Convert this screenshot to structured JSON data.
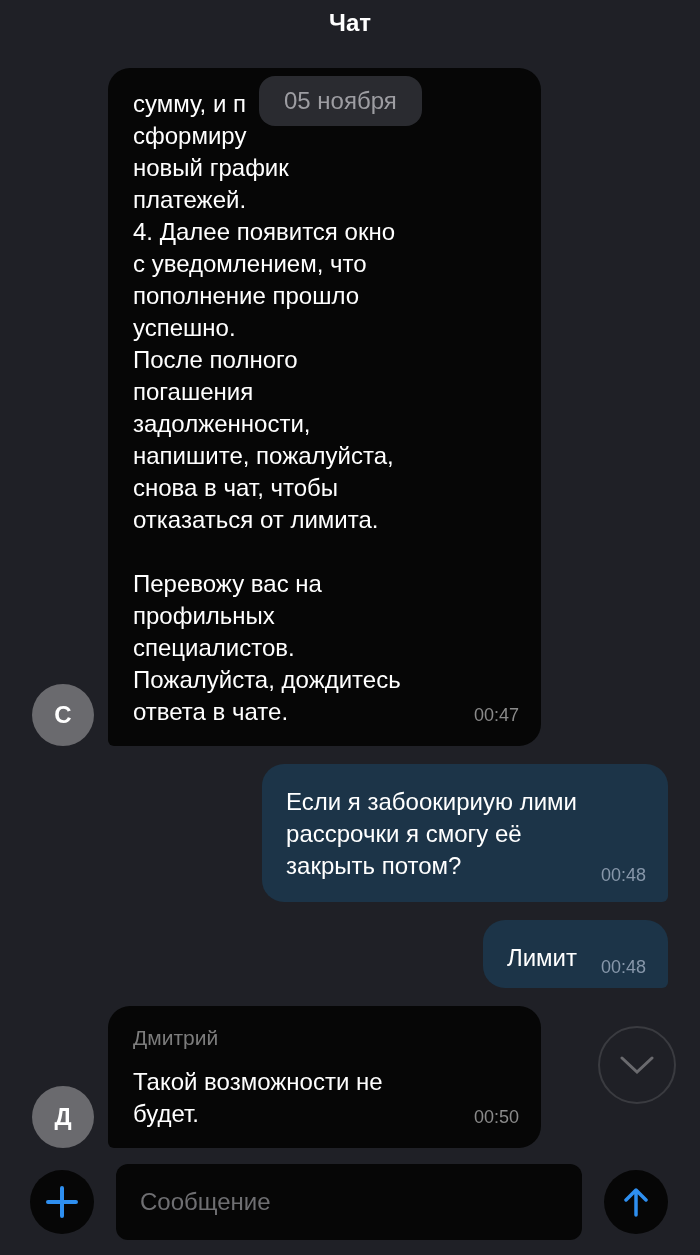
{
  "header": {
    "title": "Чат"
  },
  "date_separator": "05 ноября",
  "messages": [
    {
      "kind": "incoming",
      "avatar": "С",
      "hidden_lines": "сумму, и п\nсформиру",
      "text": "новый график\nплатежей.\n4. Далее появится окно\nс уведомлением, что\nпополнение прошло\nуспешно.\nПосле полного\nпогашения\nзадолженности,\nнапишите, пожалуйста,\nснова в чат, чтобы\nотказаться от лимита.\n\nПеревожу вас на\nпрофильных\nспециалистов.\nПожалуйста, дождитесь\nответа в чате.",
      "time": "00:47"
    },
    {
      "kind": "outgoing",
      "text": "Если я забоокириую лими\nрассрочки я смогу её\nзакрыть потом?",
      "time": "00:48"
    },
    {
      "kind": "outgoing",
      "text": "Лимит",
      "time": "00:48"
    },
    {
      "kind": "incoming",
      "avatar": "Д",
      "sender": "Дмитрий",
      "text": "Такой возможности не\nбудет.",
      "time": "00:50"
    }
  ],
  "composer": {
    "placeholder": "Сообщение"
  }
}
